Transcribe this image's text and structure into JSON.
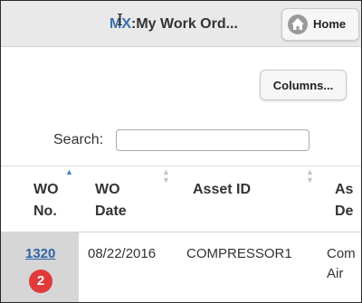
{
  "header": {
    "title_logo": "MX",
    "title_text": ":My Work Ord...",
    "home_label": "Home"
  },
  "toolbar": {
    "columns_label": "Columns..."
  },
  "search": {
    "label": "Search:",
    "value": "",
    "placeholder": ""
  },
  "table": {
    "columns": [
      {
        "label_line1": "WO",
        "label_line2": "No."
      },
      {
        "label_line1": "WO",
        "label_line2": "Date"
      },
      {
        "label_line1": "Asset ID",
        "label_line2": ""
      },
      {
        "label_line1": "As",
        "label_line2": "De"
      }
    ],
    "rows": [
      {
        "wo_no": "1320",
        "badge": "2",
        "wo_date": "08/22/2016",
        "asset_id": "COMPRESSOR1",
        "asset_desc_line1": "Com",
        "asset_desc_line2": "Air"
      }
    ]
  },
  "colors": {
    "link": "#2f63a8",
    "badge": "#e03a3a",
    "header_bg": "#e9e9e9"
  }
}
